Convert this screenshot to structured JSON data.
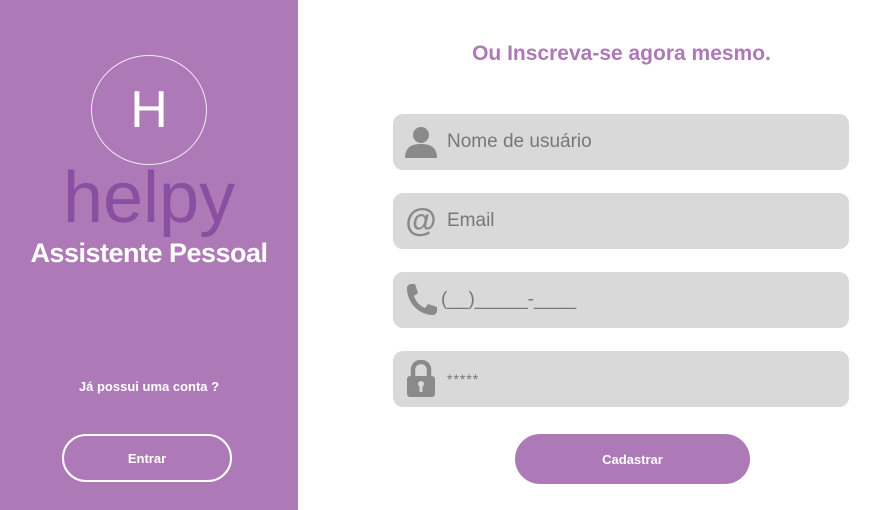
{
  "sidebar": {
    "logo_letter": "H",
    "brand_name": "helpy",
    "tagline": "Assistente Pessoal",
    "account_question": "Já possui uma conta ?",
    "login_button": "Entrar"
  },
  "signup": {
    "heading": "Ou Inscreva-se agora mesmo.",
    "username_placeholder": "Nome de usuário",
    "email_placeholder": "Email",
    "phone_placeholder": "(__)_____-____",
    "password_placeholder": "*****",
    "submit_button": "Cadastrar"
  },
  "colors": {
    "accent": "#ad79b6",
    "brand_text": "#8a4fa0",
    "field_bg": "#d9d9d9",
    "icon": "#8a8a8a"
  },
  "icons": {
    "username": "user-icon",
    "email": "at-sign-icon",
    "phone": "phone-icon",
    "password": "lock-icon"
  }
}
